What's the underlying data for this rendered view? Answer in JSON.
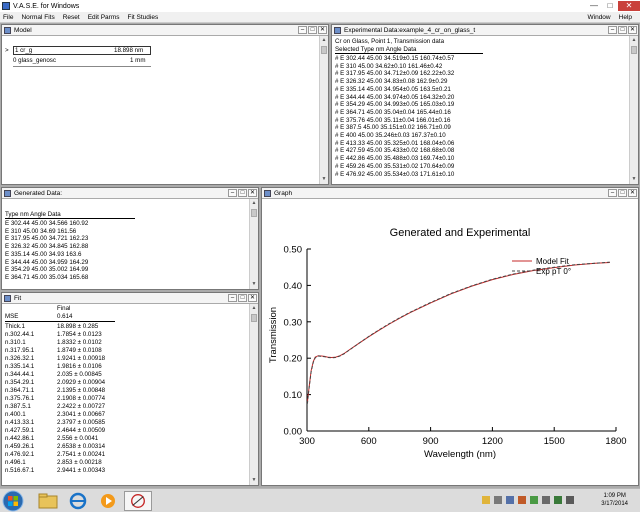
{
  "app": {
    "title": "V.A.S.E. for Windows"
  },
  "menu": {
    "left": [
      "File",
      "Normal Fits",
      "Reset",
      "Edit Parms",
      "Fit Studies"
    ],
    "right": [
      "Window",
      "Help"
    ]
  },
  "model": {
    "title": "Model",
    "rows": [
      {
        "marker": ">",
        "name": "1  cr_g",
        "value": "18.898 nm"
      },
      {
        "marker": "",
        "name": "0  glass_genosc",
        "value": "1 mm"
      }
    ]
  },
  "experimental": {
    "title": "Experimental Data:example_4_cr_on_glass_t",
    "subtitle": "Cr on Glass, Point 1, Transmission data",
    "header": "Selected Type  nm  Angle  Data",
    "rows": [
      "#  E  302.44  45.00  34.519±0.15  160.74±0.57",
      "#  E  310  45.00  34.62±0.10  161.46±0.42",
      "#  E  317.95  45.00  34.712±0.09  162.22±0.32",
      "#  E  326.32  45.00  34.83±0.08  162.9±0.29",
      "#  E  335.14  45.00  34.954±0.05  163.5±0.21",
      "#  E  344.44  45.00  34.974±0.05  164.32±0.20",
      "#  E  354.29  45.00  34.993±0.05  165.03±0.19",
      "#  E  364.71  45.00  35.04±0.04  165.44±0.16",
      "#  E  375.76  45.00  35.11±0.04  166.01±0.16",
      "#  E  387.5  45.00  35.151±0.02  166.71±0.09",
      "#  E  400  45.00  35.246±0.03  167.37±0.10",
      "#  E  413.33  45.00  35.325±0.01  168.04±0.06",
      "#  E  427.59  45.00  35.433±0.02  168.68±0.08",
      "#  E  442.86  45.00  35.488±0.03  169.74±0.10",
      "#  E  459.26  45.00  35.531±0.02  170.64±0.09",
      "#  E  476.92  45.00  35.534±0.03  171.61±0.10"
    ]
  },
  "generated": {
    "title": "Generated Data:",
    "header": "Type  nm  Angle  Data",
    "rows": [
      "E  302.44  45.00  34.566  160.92",
      "E  310  45.00  34.69  161.56",
      "E  317.95  45.00  34.721  162.23",
      "E  326.32  45.00  34.845  162.88",
      "E  335.14  45.00  34.93  163.6",
      "E  344.44  45.00  34.959  164.29",
      "E  354.29  45.00  35.002  164.99",
      "E  364.71  45.00  35.034  165.68"
    ]
  },
  "fit": {
    "title": "Fit",
    "col_header": "Final",
    "mse_label": "MSE",
    "mse_value": "0.614",
    "rows": [
      {
        "name": "Thick.1",
        "value": "18.898 ± 0.285"
      },
      {
        "name": "n.302.44.1",
        "value": "1.7854 ± 0.0123"
      },
      {
        "name": "n.310.1",
        "value": "1.8332 ± 0.0102"
      },
      {
        "name": "n.317.95.1",
        "value": "1.8749 ± 0.0108"
      },
      {
        "name": "n.326.32.1",
        "value": "1.9241 ± 0.00918"
      },
      {
        "name": "n.335.14.1",
        "value": "1.9816 ± 0.0106"
      },
      {
        "name": "n.344.44.1",
        "value": "2.035 ± 0.00845"
      },
      {
        "name": "n.354.29.1",
        "value": "2.0929 ± 0.00904"
      },
      {
        "name": "n.364.71.1",
        "value": "2.1395 ± 0.00848"
      },
      {
        "name": "n.375.76.1",
        "value": "2.1908 ± 0.00774"
      },
      {
        "name": "n.387.5.1",
        "value": "2.2422 ± 0.00727"
      },
      {
        "name": "n.400.1",
        "value": "2.3041 ± 0.00667"
      },
      {
        "name": "n.413.33.1",
        "value": "2.3797 ± 0.00585"
      },
      {
        "name": "n.427.59.1",
        "value": "2.4644 ± 0.00509"
      },
      {
        "name": "n.442.86.1",
        "value": "2.556 ± 0.0041"
      },
      {
        "name": "n.459.26.1",
        "value": "2.6538 ± 0.00314"
      },
      {
        "name": "n.476.92.1",
        "value": "2.7541 ± 0.00241"
      },
      {
        "name": "n.496.1",
        "value": "2.853 ± 0.00218"
      },
      {
        "name": "n.516.67.1",
        "value": "2.9441 ± 0.00343"
      }
    ]
  },
  "graph": {
    "title": "Graph"
  },
  "chart_data": {
    "type": "line",
    "title": "Generated and Experimental",
    "xlabel": "Wavelength (nm)",
    "ylabel": "Transmission",
    "xlim": [
      300,
      1800
    ],
    "ylim": [
      0,
      0.5
    ],
    "xticks": [
      "300",
      "600",
      "900",
      "1200",
      "1500",
      "1800"
    ],
    "yticks": [
      "0.00",
      "0.10",
      "0.20",
      "0.30",
      "0.40",
      "0.50"
    ],
    "legend_position": "right",
    "series": [
      {
        "name": "Model Fit",
        "style": "solid",
        "color": "#c62828",
        "x": [
          302,
          310,
          320,
          330,
          340,
          355,
          370,
          385,
          400,
          420,
          440,
          460,
          480,
          500,
          550,
          600,
          650,
          700,
          750,
          800,
          900,
          1000,
          1100,
          1200,
          1300,
          1400,
          1500,
          1600,
          1700,
          1770
        ],
        "y": [
          0.08,
          0.12,
          0.165,
          0.19,
          0.203,
          0.207,
          0.206,
          0.205,
          0.203,
          0.202,
          0.203,
          0.207,
          0.213,
          0.221,
          0.24,
          0.259,
          0.277,
          0.294,
          0.31,
          0.325,
          0.352,
          0.377,
          0.398,
          0.416,
          0.43,
          0.441,
          0.449,
          0.456,
          0.461,
          0.463
        ]
      },
      {
        "name": "Exp pT 0°",
        "style": "dashed",
        "color": "#444444",
        "x": [
          302,
          310,
          320,
          330,
          340,
          355,
          370,
          385,
          400,
          420,
          440,
          460,
          480,
          500,
          550,
          600,
          650,
          700,
          750,
          800,
          900,
          1000,
          1100,
          1200,
          1300,
          1400,
          1500,
          1600,
          1700,
          1770
        ],
        "y": [
          0.075,
          0.118,
          0.162,
          0.188,
          0.201,
          0.206,
          0.205,
          0.204,
          0.202,
          0.201,
          0.202,
          0.206,
          0.212,
          0.22,
          0.24,
          0.26,
          0.278,
          0.295,
          0.311,
          0.326,
          0.353,
          0.378,
          0.399,
          0.417,
          0.431,
          0.442,
          0.45,
          0.457,
          0.461,
          0.464
        ]
      }
    ]
  },
  "taskbar": {
    "time": "1:09 PM",
    "date": "3/17/2014"
  }
}
